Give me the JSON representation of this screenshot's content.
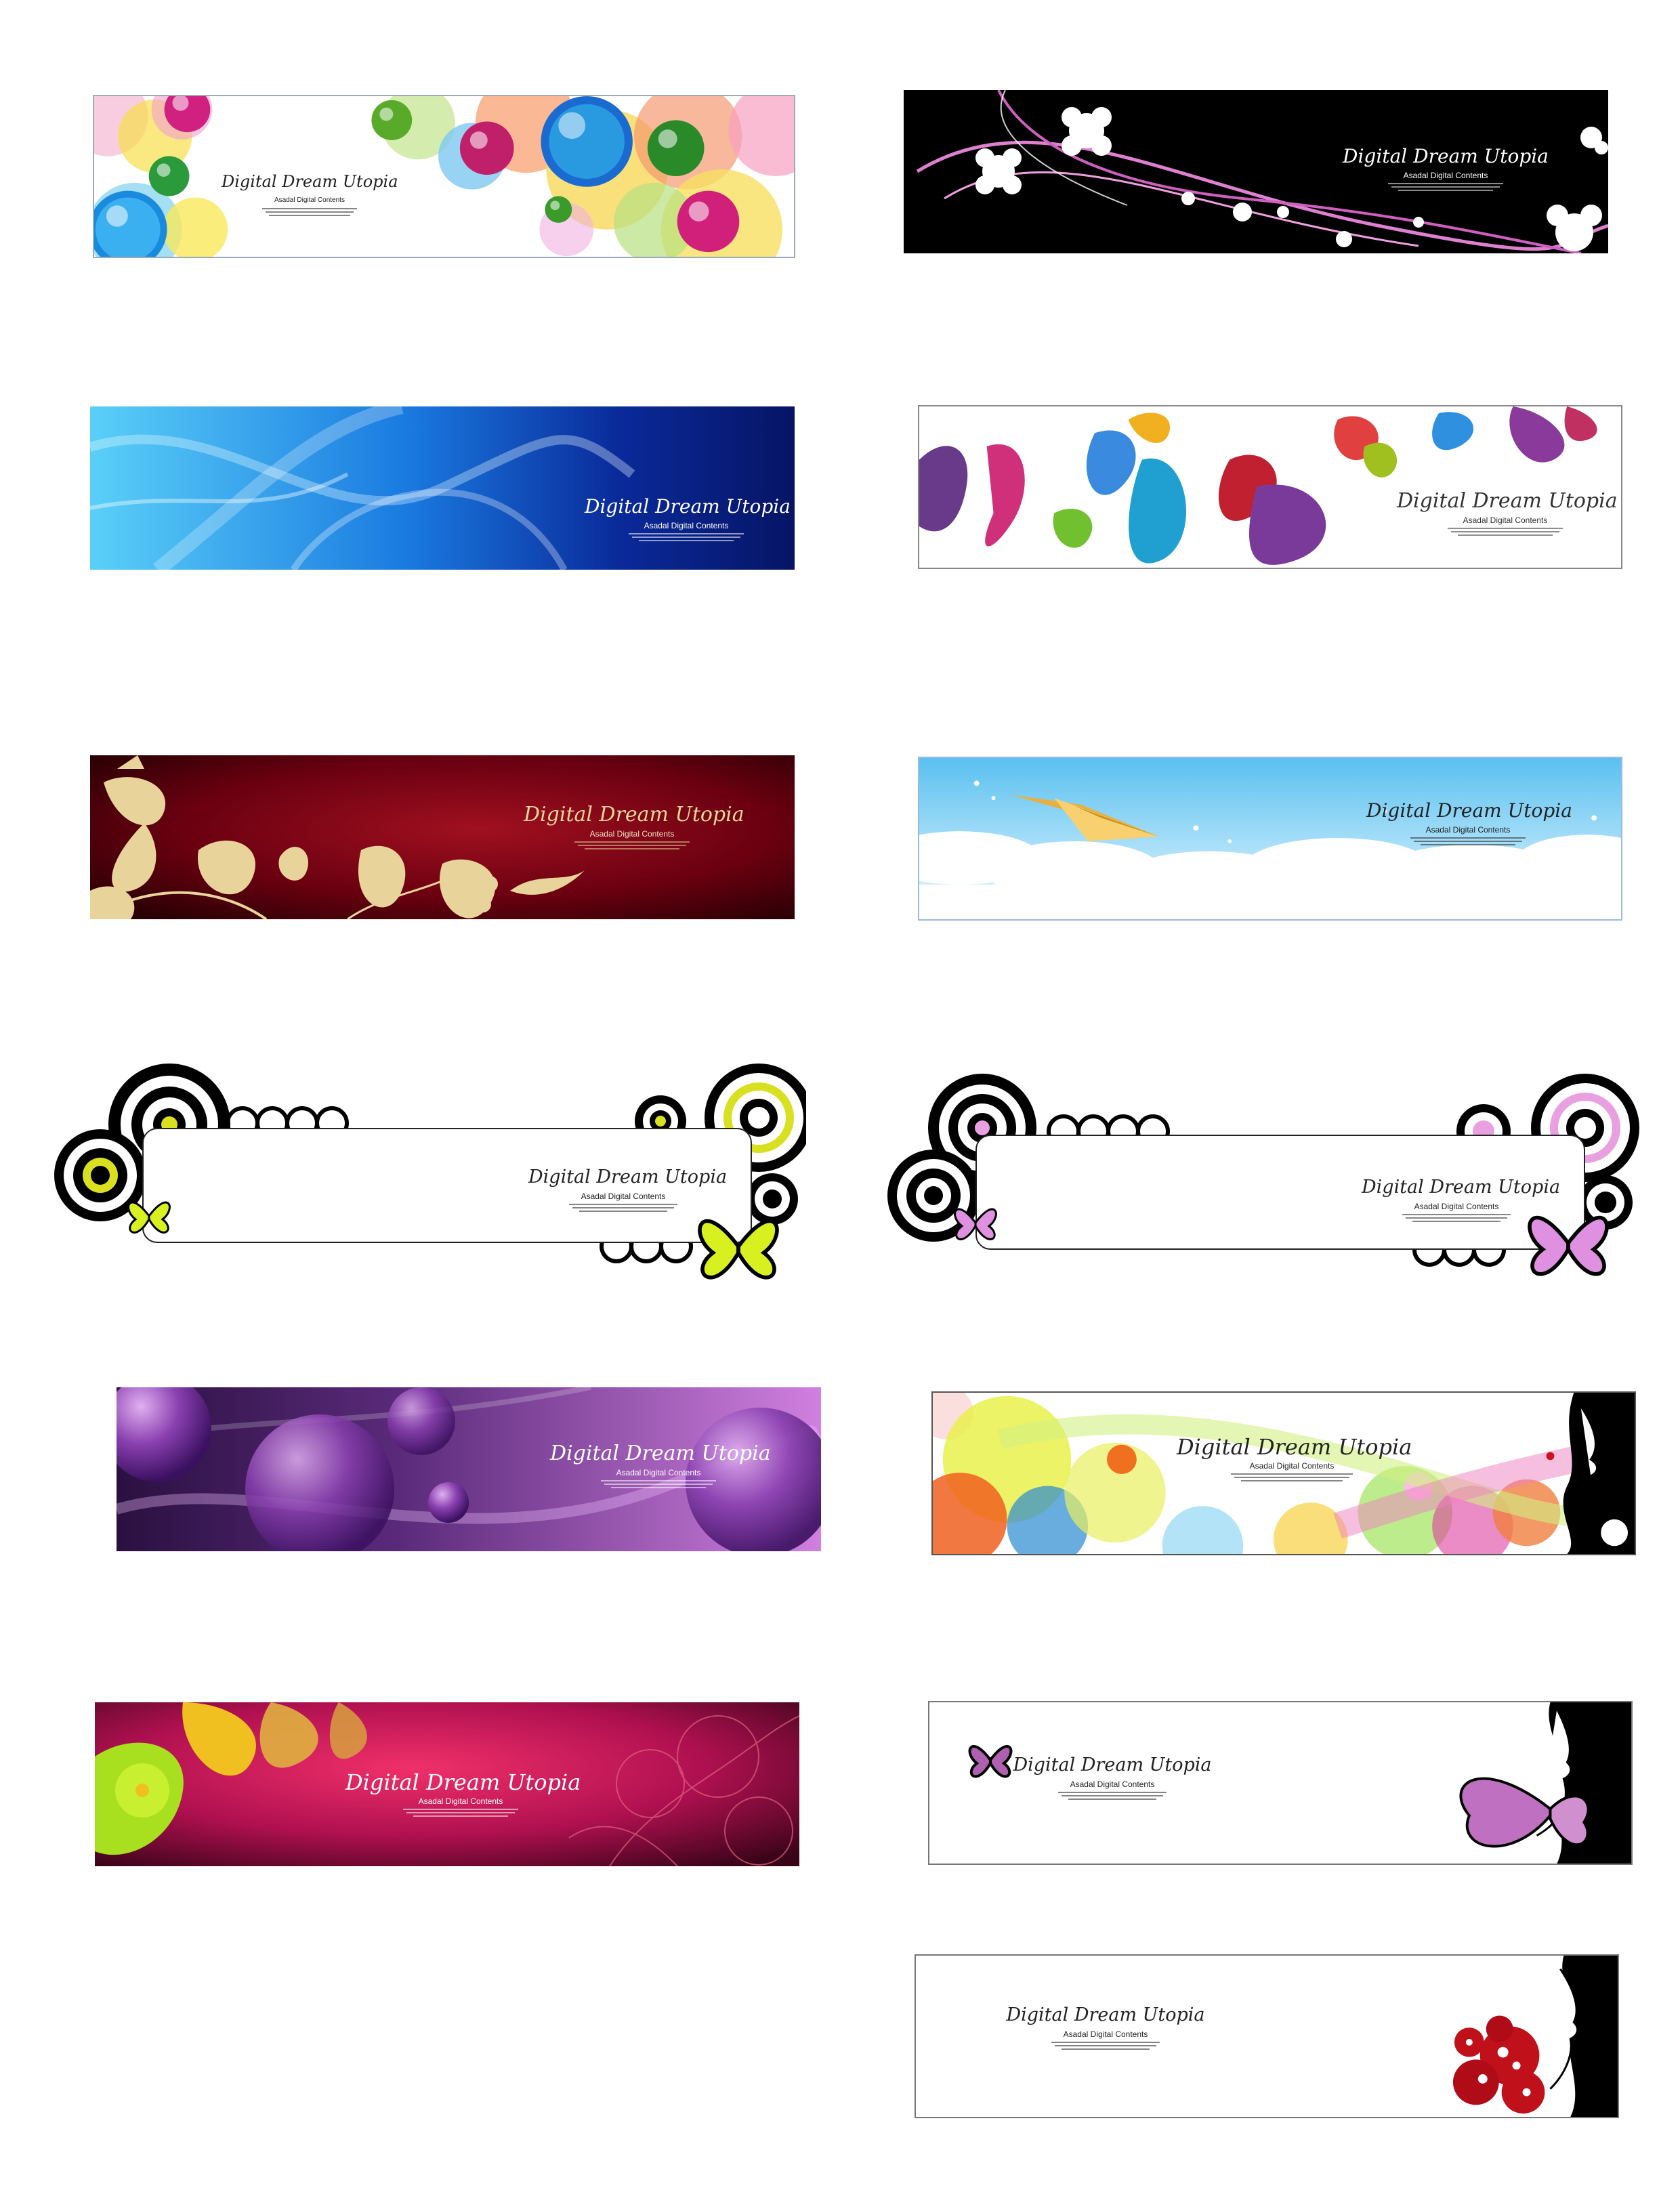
{
  "banners": [
    {
      "title": "Digital Dream Utopia",
      "subtitle": "Asadal Digital Contents"
    },
    {
      "title": "Digital Dream Utopia",
      "subtitle": "Asadal Digital Contents"
    },
    {
      "title": "Digital Dream Utopia",
      "subtitle": "Asadal Digital Contents"
    },
    {
      "title": "Digital Dream Utopia",
      "subtitle": "Asadal Digital Contents"
    },
    {
      "title": "Digital Dream Utopia",
      "subtitle": "Asadal Digital Contents"
    },
    {
      "title": "Digital Dream Utopia",
      "subtitle": "Asadal Digital Contents"
    },
    {
      "title": "Digital Dream Utopia",
      "subtitle": "Asadal Digital Contents"
    },
    {
      "title": "Digital Dream Utopia",
      "subtitle": "Asadal Digital Contents"
    },
    {
      "title": "Digital Dream Utopia",
      "subtitle": "Asadal Digital Contents"
    },
    {
      "title": "Digital Dream Utopia",
      "subtitle": "Asadal Digital Contents"
    },
    {
      "title": "Digital Dream Utopia",
      "subtitle": "Asadal Digital Contents"
    },
    {
      "title": "Digital Dream Utopia",
      "subtitle": "Asadal Digital Contents"
    },
    {
      "title": "Digital Dream Utopia",
      "subtitle": "Asadal Digital Contents"
    }
  ],
  "colors": {
    "page_background": "#ffffff",
    "black": "#000000",
    "navy": "#0a1a6e",
    "sky_blue": "#4fc3f7",
    "burgundy": "#5a0010",
    "gold": "#e8d49a",
    "purple": "#6a2a8a",
    "lavender": "#c070d0",
    "magenta": "#d0185a",
    "lime": "#a8e020",
    "pink": "#e070c0",
    "red": "#c0101a"
  },
  "icons": [
    "bubble-icon",
    "cherry-blossom-icon",
    "paint-splash-icon",
    "floral-silhouette-icon",
    "paper-plane-icon",
    "concentric-circle-icon",
    "butterfly-icon",
    "hibiscus-icon",
    "woman-silhouette-icon",
    "rose-icon"
  ]
}
